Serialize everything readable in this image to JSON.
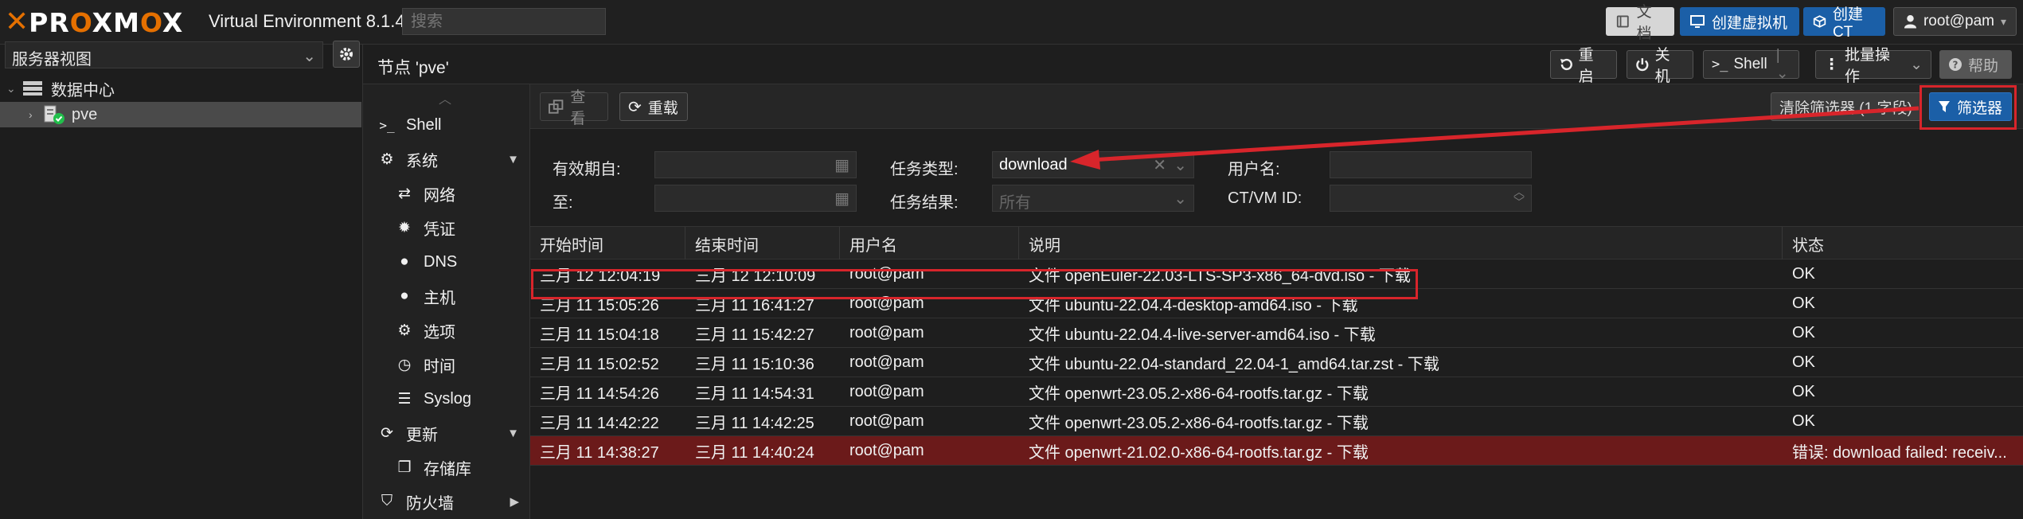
{
  "topbar": {
    "brand_x": "✕",
    "brand_pre": "PR",
    "brand_o": "O",
    "brand_post": "XM",
    "brand_o2": "O",
    "brand_x2": "X",
    "subtitle": "Virtual Environment 8.1.4",
    "search_placeholder": "搜索",
    "docs_label": "文档",
    "create_vm_label": "创建虚拟机",
    "create_ct_label": "创建CT",
    "user_label": "root@pam"
  },
  "tree": {
    "view_label": "服务器视图",
    "datacenter_label": "数据中心",
    "node_label": "pve"
  },
  "node_header": {
    "title": "节点 'pve'",
    "reboot_label": "重启",
    "shutdown_label": "关机",
    "shell_label": "Shell",
    "bulk_label": "批量操作",
    "help_label": "帮助"
  },
  "nav": [
    {
      "label": "Shell",
      "icon": "terminal-icon"
    },
    {
      "label": "系统",
      "icon": "cogs-icon"
    },
    {
      "label": "网络",
      "icon": "exchange-icon"
    },
    {
      "label": "凭证",
      "icon": "certificate-icon"
    },
    {
      "label": "DNS",
      "icon": "globe-icon"
    },
    {
      "label": "主机",
      "icon": "globe-icon"
    },
    {
      "label": "选项",
      "icon": "gear-icon"
    },
    {
      "label": "时间",
      "icon": "clock-icon"
    },
    {
      "label": "Syslog",
      "icon": "list-icon"
    },
    {
      "label": "更新",
      "icon": "refresh-icon"
    },
    {
      "label": "存储库",
      "icon": "files-icon"
    },
    {
      "label": "防火墙",
      "icon": "shield-icon"
    }
  ],
  "toolbar": {
    "view_label": "查看",
    "reload_label": "重载",
    "clear_filter_label": "清除筛选器 (1 字段)",
    "filter_label": "筛选器"
  },
  "filter": {
    "since_label": "有效期自:",
    "until_label": "至:",
    "task_type_label": "任务类型:",
    "task_type_value": "download",
    "task_result_label": "任务结果:",
    "task_result_placeholder": "所有",
    "user_label": "用户名:",
    "vmid_label": "CT/VM ID:"
  },
  "grid": {
    "columns": [
      "开始时间",
      "结束时间",
      "用户名",
      "说明",
      "状态"
    ],
    "rows": [
      {
        "start": "三月 12 12:04:19",
        "end": "三月 12 12:10:09",
        "user": "root@pam",
        "desc": "文件 openEuler-22.03-LTS-SP3-x86_64-dvd.iso - 下载",
        "status": "OK",
        "error": false
      },
      {
        "start": "三月 11 15:05:26",
        "end": "三月 11 16:41:27",
        "user": "root@pam",
        "desc": "文件 ubuntu-22.04.4-desktop-amd64.iso - 下载",
        "status": "OK",
        "error": false
      },
      {
        "start": "三月 11 15:04:18",
        "end": "三月 11 15:42:27",
        "user": "root@pam",
        "desc": "文件 ubuntu-22.04.4-live-server-amd64.iso - 下载",
        "status": "OK",
        "error": false
      },
      {
        "start": "三月 11 15:02:52",
        "end": "三月 11 15:10:36",
        "user": "root@pam",
        "desc": "文件 ubuntu-22.04-standard_22.04-1_amd64.tar.zst - 下载",
        "status": "OK",
        "error": false
      },
      {
        "start": "三月 11 14:54:26",
        "end": "三月 11 14:54:31",
        "user": "root@pam",
        "desc": "文件 openwrt-23.05.2-x86-64-rootfs.tar.gz - 下载",
        "status": "OK",
        "error": false
      },
      {
        "start": "三月 11 14:42:22",
        "end": "三月 11 14:42:25",
        "user": "root@pam",
        "desc": "文件 openwrt-23.05.2-x86-64-rootfs.tar.gz - 下载",
        "status": "OK",
        "error": false
      },
      {
        "start": "三月 11 14:38:27",
        "end": "三月 11 14:40:24",
        "user": "root@pam",
        "desc": "文件 openwrt-21.02.0-x86-64-rootfs.tar.gz - 下载",
        "status": "错误: download failed: receiv...",
        "error": true
      }
    ]
  },
  "colors": {
    "accent": "#e57000",
    "brand_blue": "#1b5fa7",
    "error_row": "#6b1a1a",
    "annotation": "#d8252b"
  }
}
